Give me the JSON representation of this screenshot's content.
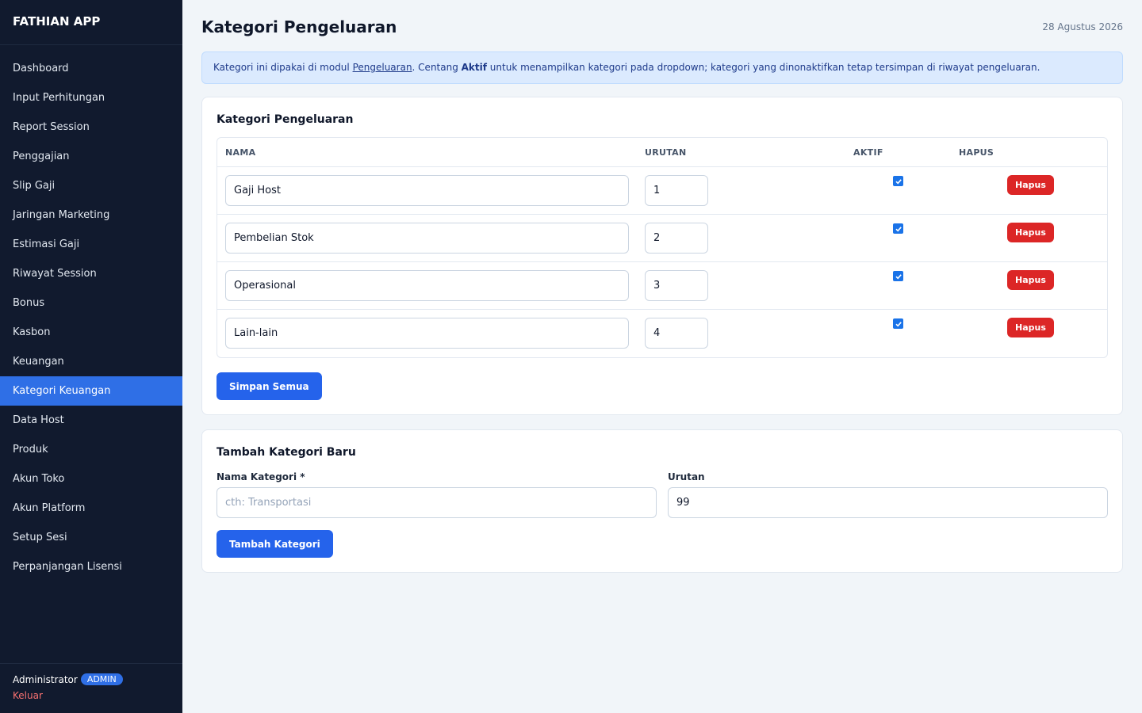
{
  "app": {
    "brand": "FATHIAN APP"
  },
  "sidebar": {
    "items": [
      {
        "label": "Dashboard"
      },
      {
        "label": "Input Perhitungan"
      },
      {
        "label": "Report Session"
      },
      {
        "label": "Penggajian"
      },
      {
        "label": "Slip Gaji"
      },
      {
        "label": "Jaringan Marketing"
      },
      {
        "label": "Estimasi Gaji"
      },
      {
        "label": "Riwayat Session"
      },
      {
        "label": "Bonus"
      },
      {
        "label": "Kasbon"
      },
      {
        "label": "Keuangan"
      },
      {
        "label": "Kategori Keuangan",
        "active": true
      },
      {
        "label": "Data Host"
      },
      {
        "label": "Produk"
      },
      {
        "label": "Akun Toko"
      },
      {
        "label": "Akun Platform"
      },
      {
        "label": "Setup Sesi"
      },
      {
        "label": "Perpanjangan Lisensi"
      }
    ],
    "footer": {
      "user": "Administrator",
      "role": "ADMIN",
      "logout": "Keluar"
    }
  },
  "header": {
    "title": "Kategori Pengeluaran",
    "date": "28 Agustus 2026"
  },
  "info": {
    "part1": "Kategori ini dipakai di modul ",
    "link": "Pengeluaran",
    "part2": ". Centang ",
    "bold": "Aktif",
    "part3": " untuk menampilkan kategori pada dropdown; kategori yang dinonaktifkan tetap tersimpan di riwayat pengeluaran."
  },
  "list_card": {
    "title": "Kategori Pengeluaran",
    "columns": {
      "name": "NAMA",
      "order": "URUTAN",
      "active": "AKTIF",
      "delete": "HAPUS"
    },
    "rows": [
      {
        "name": "Gaji Host",
        "order": "1",
        "active": true,
        "delete_label": "Hapus"
      },
      {
        "name": "Pembelian Stok",
        "order": "2",
        "active": true,
        "delete_label": "Hapus"
      },
      {
        "name": "Operasional",
        "order": "3",
        "active": true,
        "delete_label": "Hapus"
      },
      {
        "name": "Lain-lain",
        "order": "4",
        "active": true,
        "delete_label": "Hapus"
      }
    ],
    "save_label": "Simpan Semua"
  },
  "add_card": {
    "title": "Tambah Kategori Baru",
    "name_label": "Nama Kategori *",
    "name_placeholder": "cth: Transportasi",
    "name_value": "",
    "order_label": "Urutan",
    "order_value": "99",
    "submit_label": "Tambah Kategori"
  },
  "colors": {
    "sidebar_bg": "#111a2e",
    "accent": "#2563eb",
    "active_nav": "#2f6fe6",
    "danger": "#dc2626",
    "logout": "#f87171",
    "info_bg": "#dbeafe"
  },
  "icons": {
    "checkbox": "check-icon"
  }
}
